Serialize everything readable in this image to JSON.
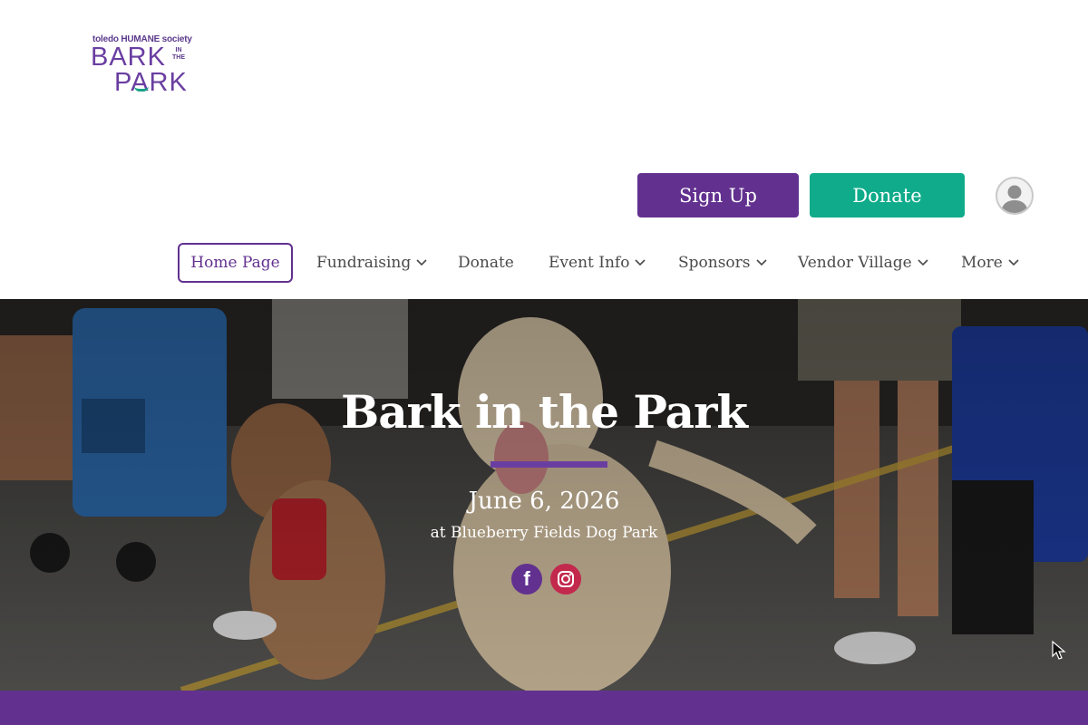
{
  "logo": {
    "org": "toledo HUMANE society",
    "line1": "BARK",
    "in_the": "IN THE",
    "line2": "PARK",
    "primary_color": "#6a3ea1",
    "accent_color": "#1aa388"
  },
  "header": {
    "signup_label": "Sign Up",
    "donate_label": "Donate",
    "avatar_icon": "user-avatar-icon"
  },
  "nav": {
    "items": [
      {
        "label": "Home Page",
        "active": true
      },
      {
        "label": "Fundraising",
        "dropdown": true
      },
      {
        "label": "Donate",
        "dropdown": false
      },
      {
        "label": "Event Info",
        "dropdown": true
      },
      {
        "label": "Sponsors",
        "dropdown": true
      },
      {
        "label": "Vendor Village",
        "dropdown": true
      },
      {
        "label": "More",
        "dropdown": true
      }
    ]
  },
  "hero": {
    "title": "Bark in the Park",
    "date": "June 6, 2026",
    "venue": "at Blueberry Fields Dog Park",
    "social": [
      "facebook-icon",
      "instagram-icon"
    ]
  },
  "colors": {
    "purple": "#62318f",
    "teal": "#0fab8a",
    "instagram": "#c2294d"
  }
}
